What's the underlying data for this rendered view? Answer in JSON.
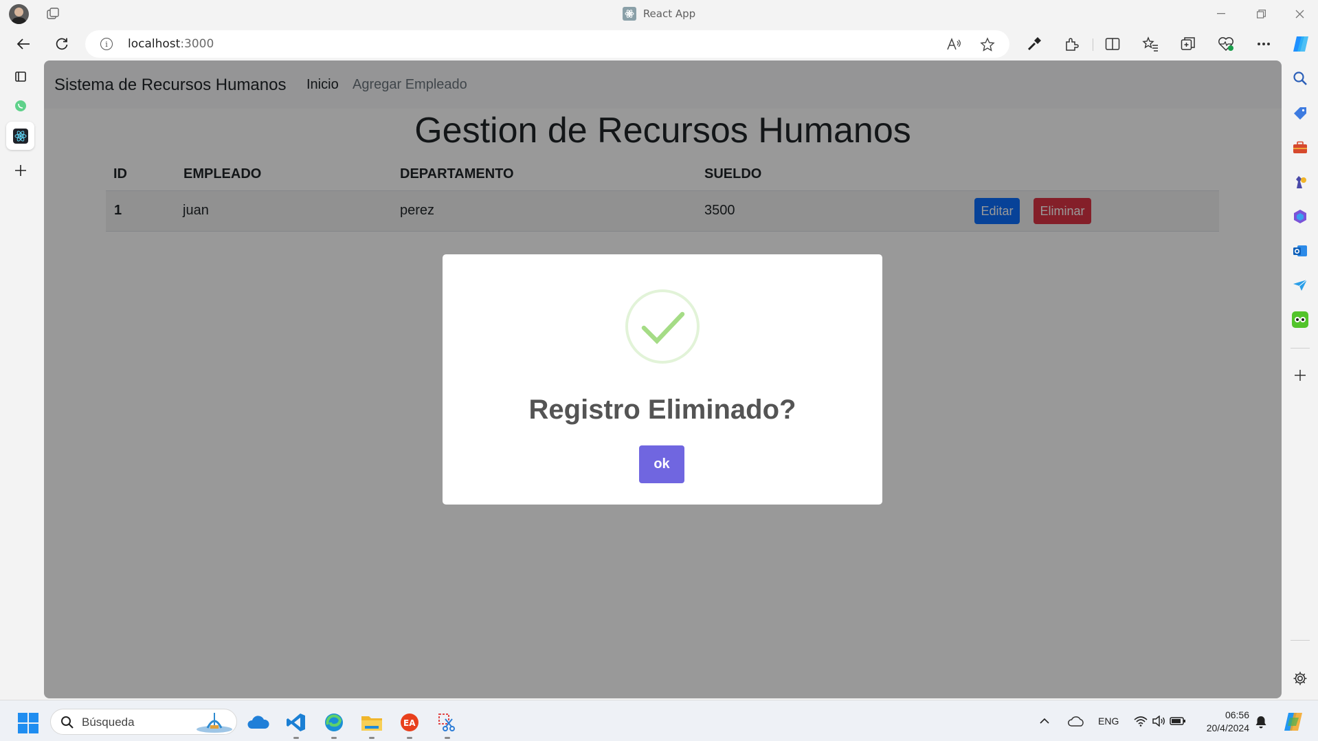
{
  "browser": {
    "window_title": "React App",
    "url_host": "localhost",
    "url_port": ":3000"
  },
  "app": {
    "brand": "Sistema de Recursos Humanos",
    "nav": [
      {
        "label": "Inicio",
        "active": true
      },
      {
        "label": "Agregar Empleado",
        "active": false
      }
    ],
    "heading": "Gestion de Recursos Humanos",
    "table": {
      "headers": [
        "ID",
        "EMPLEADO",
        "DEPARTAMENTO",
        "SUELDO"
      ],
      "rows": [
        {
          "id": "1",
          "empleado": "juan",
          "departamento": "perez",
          "sueldo": "3500"
        }
      ],
      "edit_label": "Editar",
      "delete_label": "Eliminar"
    }
  },
  "modal": {
    "title": "Registro Eliminado?",
    "confirm_label": "ok",
    "icon": "success-check-icon"
  },
  "taskbar": {
    "search_placeholder": "Búsqueda",
    "language": "ENG",
    "time": "06:56",
    "date": "20/4/2024"
  },
  "colors": {
    "confirm_button": "#7066e0",
    "edit_button": "#0d6efd",
    "delete_button": "#dc3545",
    "success_check": "#a5dc86"
  }
}
